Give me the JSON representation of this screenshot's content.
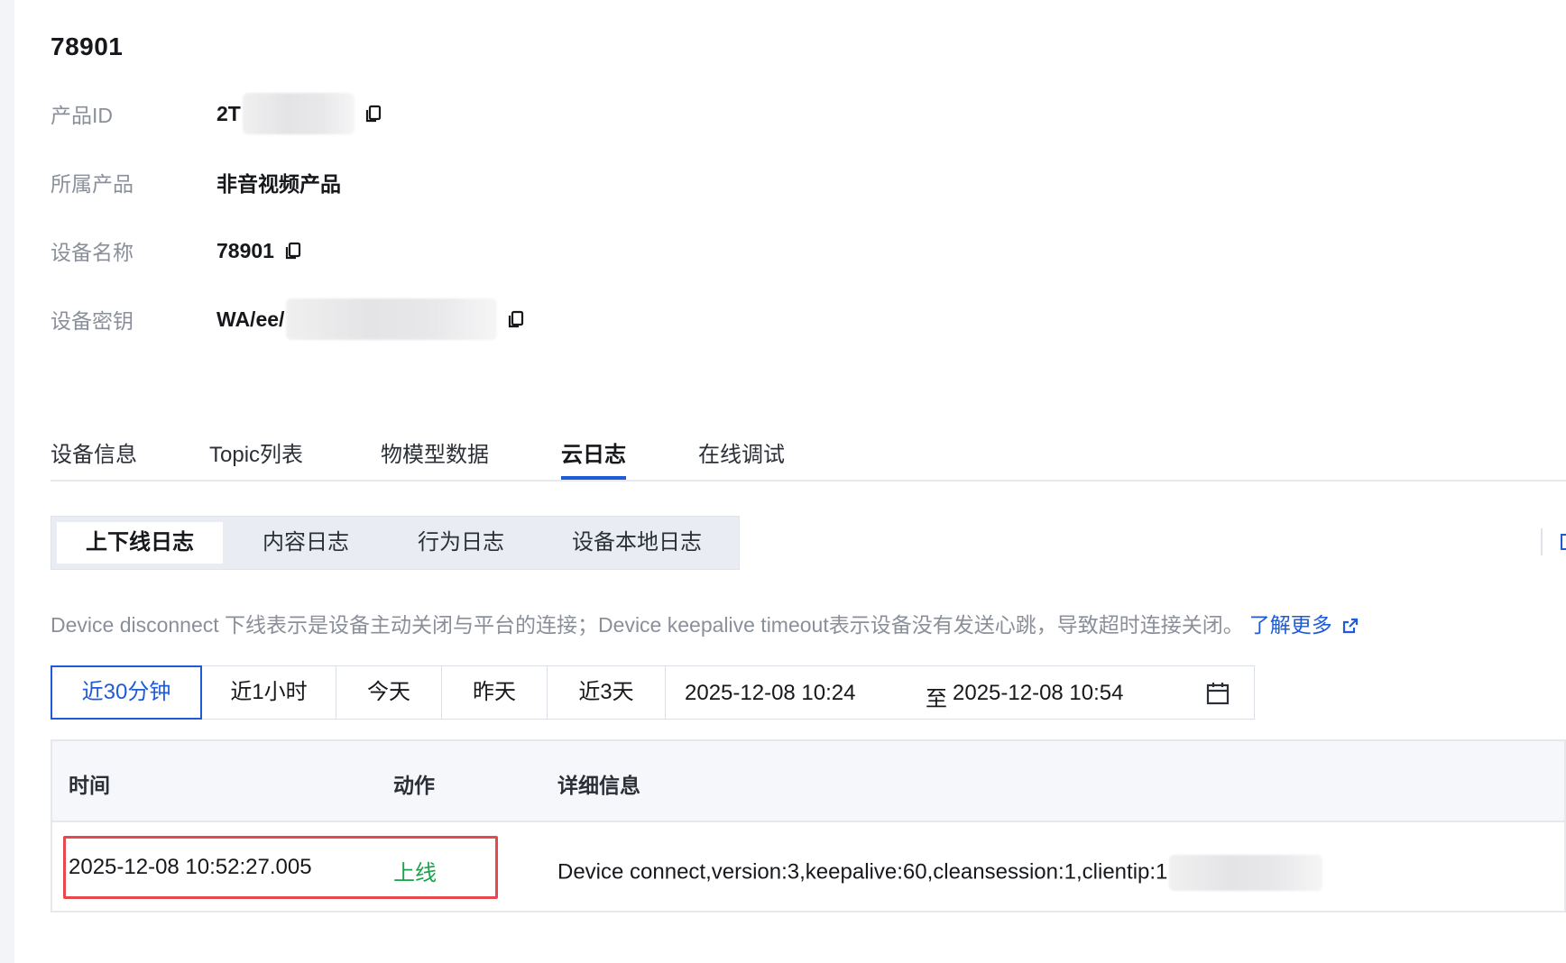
{
  "device": {
    "title": "78901"
  },
  "info": {
    "product_id_label": "产品ID",
    "product_id_value": "2T",
    "product_label": "所属产品",
    "product_value": "非音视频产品",
    "device_name_label": "设备名称",
    "device_name_value": "78901",
    "device_secret_label": "设备密钥",
    "device_secret_value": "WA/ee/"
  },
  "tabs": [
    {
      "label": "设备信息"
    },
    {
      "label": "Topic列表"
    },
    {
      "label": "物模型数据"
    },
    {
      "label": "云日志",
      "active": true
    },
    {
      "label": "在线调试"
    }
  ],
  "subtabs": [
    {
      "label": "上下线日志",
      "active": true
    },
    {
      "label": "内容日志"
    },
    {
      "label": "行为日志"
    },
    {
      "label": "设备本地日志"
    }
  ],
  "notice": {
    "text": "Device disconnect 下线表示是设备主动关闭与平台的连接；Device keepalive timeout表示设备没有发送心跳，导致超时连接关闭。",
    "link_label": "了解更多"
  },
  "time_range": {
    "options": [
      {
        "label": "近30分钟",
        "active": true
      },
      {
        "label": "近1小时"
      },
      {
        "label": "今天"
      },
      {
        "label": "昨天"
      },
      {
        "label": "近3天"
      }
    ],
    "from": "2025-12-08 10:24",
    "separator": "至",
    "to": "2025-12-08 10:54"
  },
  "table": {
    "headers": {
      "time": "时间",
      "action": "动作",
      "detail": "详细信息"
    },
    "rows": [
      {
        "time": "2025-12-08 10:52:27.005",
        "action": "上线",
        "detail": "Device connect,version:3,keepalive:60,cleansession:1,clientip:1"
      }
    ]
  },
  "icons": {
    "copy": "copy-icon",
    "external_link": "external-link-icon",
    "calendar": "calendar-icon"
  },
  "colors": {
    "accent": "#1f5bd6",
    "online": "#1aa34a",
    "highlight": "#e5484d",
    "muted_text": "#8a8f99"
  }
}
